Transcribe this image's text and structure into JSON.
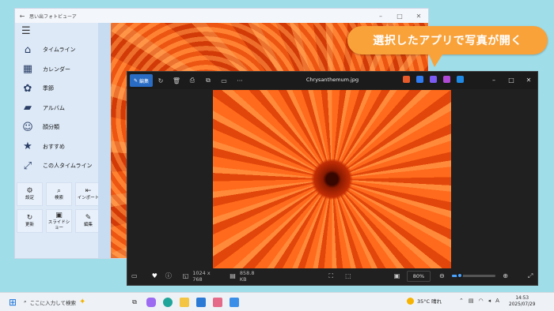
{
  "legacy_window": {
    "title": "思い出フォトビューア",
    "nav_items": [
      {
        "label": "タイムライン",
        "icon": "home-icon",
        "glyph": "⌂"
      },
      {
        "label": "カレンダー",
        "icon": "calendar-icon",
        "glyph": "▦"
      },
      {
        "label": "季節",
        "icon": "season-icon",
        "glyph": "✿"
      },
      {
        "label": "アルバム",
        "icon": "folder-icon",
        "glyph": "▰"
      },
      {
        "label": "顔分類",
        "icon": "faces-icon",
        "glyph": "☺"
      },
      {
        "label": "おすすめ",
        "icon": "star-icon",
        "glyph": "★"
      },
      {
        "label": "この人タイムライン",
        "icon": "person-timeline-icon",
        "glyph": "⤢"
      }
    ],
    "tools": [
      {
        "label": "設定",
        "icon": "gear-icon",
        "glyph": "⚙"
      },
      {
        "label": "検索",
        "icon": "search-icon",
        "glyph": "⌕"
      },
      {
        "label": "インポート",
        "icon": "import-icon",
        "glyph": "⇤"
      },
      {
        "label": "更新",
        "icon": "refresh-icon",
        "glyph": "↻"
      },
      {
        "label": "スライドショー",
        "icon": "slideshow-icon",
        "glyph": "▣"
      },
      {
        "label": "編集",
        "icon": "brush-icon",
        "glyph": "✎"
      }
    ]
  },
  "callout": {
    "text": "選択したアプリで写真が開く"
  },
  "photos_window": {
    "edit_label": "編集",
    "filename": "Chrysanthemum.jpg",
    "toolbar_icons": [
      "rotate-icon",
      "trash-icon",
      "print-icon",
      "crop-icon",
      "present-icon",
      "more-icon"
    ],
    "app_icon_colors": [
      "#e85a2a",
      "#2f7bf2",
      "#7a5af0",
      "#b04ad6",
      "#1f8ae6"
    ],
    "dimensions": "1024 x 768",
    "filesize": "858.8 KB",
    "zoom": "80%",
    "zoom_fraction": 0.18
  },
  "taskbar": {
    "search_placeholder": "ここに入力して検索",
    "weather": "35°C 晴れ",
    "time": "14:53",
    "date": "2025/07/29"
  }
}
